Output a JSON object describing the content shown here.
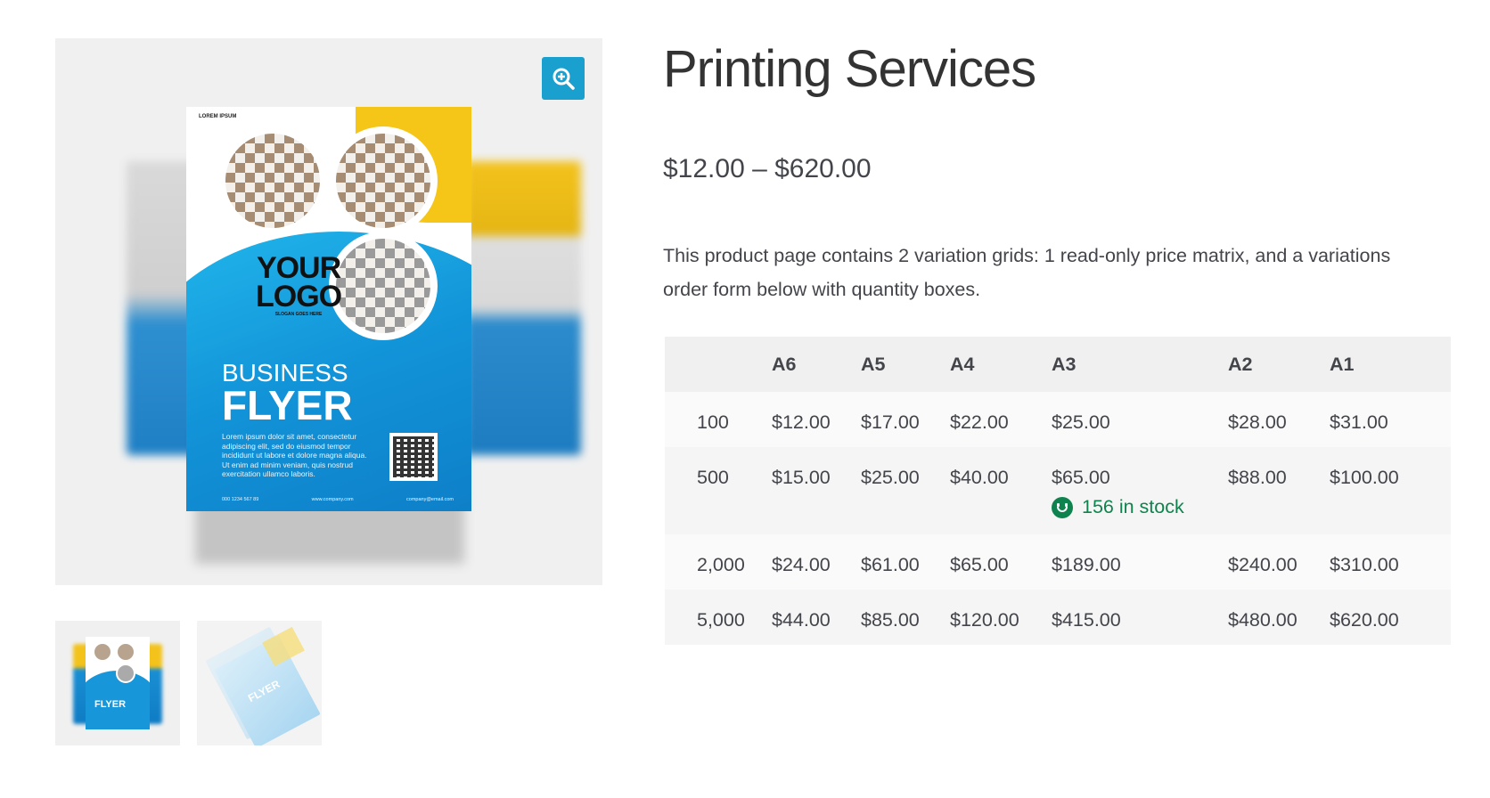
{
  "product": {
    "title": "Printing Services",
    "price_range": "$12.00 – $620.00",
    "description": "This product page contains 2 variation grids: 1 read-only price matrix, and a variations order form below with quantity boxes."
  },
  "gallery": {
    "zoom_icon": "zoom-in-icon",
    "flyer": {
      "header": "LOREM IPSUM",
      "logo_line1": "YOUR",
      "logo_line2": "LOGO",
      "logo_slogan": "SLOGAN GOES HERE",
      "title1": "BUSINESS",
      "title2": "FLYER",
      "body": "Lorem ipsum dolor sit amet, consectetur adipiscing elit, sed do eiusmod tempor incididunt ut labore et dolore magna aliqua. Ut enim ad minim veniam, quis nostrud exercitation ullamco laboris.",
      "footer_phone": "000 1234 567 89",
      "footer_web": "www.company.com",
      "footer_email": "company@email.com"
    },
    "thumbnails": [
      {
        "label": "FLYER"
      },
      {
        "label": "FLYER"
      }
    ]
  },
  "price_matrix": {
    "headers": [
      "",
      "A6",
      "A5",
      "A4",
      "A3",
      "A2",
      "A1"
    ],
    "rows": [
      {
        "qty": "100",
        "prices": [
          "$12.00",
          "$17.00",
          "$22.00",
          "$25.00",
          "$28.00",
          "$31.00"
        ]
      },
      {
        "qty": "500",
        "prices": [
          "$15.00",
          "$25.00",
          "$40.00",
          "$65.00",
          "$88.00",
          "$100.00"
        ],
        "stock_note": "156 in stock"
      },
      {
        "qty": "2,000",
        "prices": [
          "$24.00",
          "$61.00",
          "$65.00",
          "$189.00",
          "$240.00",
          "$310.00"
        ]
      },
      {
        "qty": "5,000",
        "prices": [
          "$44.00",
          "$85.00",
          "$120.00",
          "$415.00",
          "$480.00",
          "$620.00"
        ]
      }
    ]
  },
  "colors": {
    "accent": "#1aa0cf",
    "in_stock": "#0f834d",
    "text": "#43454b"
  }
}
